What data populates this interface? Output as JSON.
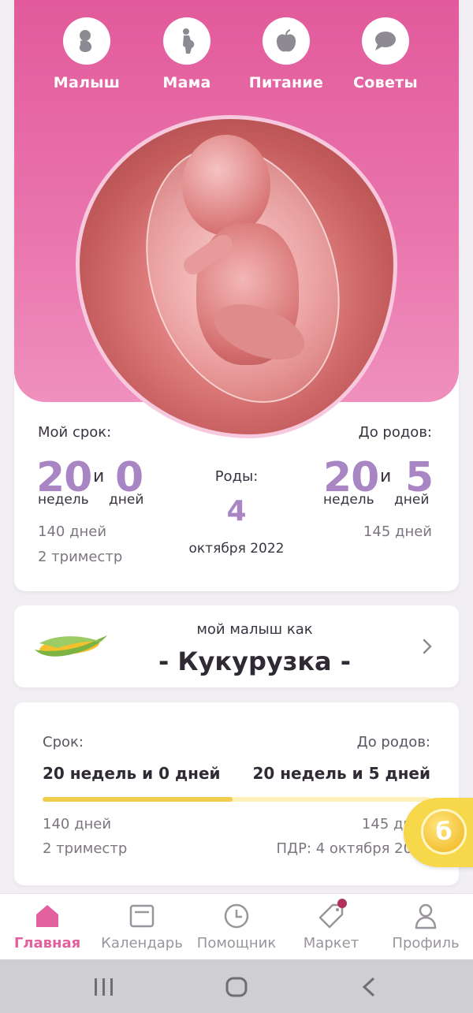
{
  "categories": [
    {
      "label": "Малыш",
      "icon": "baby-icon"
    },
    {
      "label": "Мама",
      "icon": "pregnant-mother-icon"
    },
    {
      "label": "Питание",
      "icon": "apple-icon"
    },
    {
      "label": "Советы",
      "icon": "chat-bubble-icon"
    }
  ],
  "summary": {
    "my_term_label": "Мой срок:",
    "my_weeks": "20",
    "my_and": "и",
    "my_days": "0",
    "weeks_unit": "недель",
    "days_unit": "дней",
    "my_total_days": "140 дней",
    "trimester": "2 триместр",
    "birth_label": "Роды:",
    "birth_day": "4",
    "birth_month_year": "октября 2022",
    "to_birth_label": "До родов:",
    "left_weeks": "20",
    "left_and": "и",
    "left_days": "5",
    "left_total_days": "145 дней"
  },
  "fruit": {
    "caption": "мой малыш как",
    "name": "- Кукурузка -",
    "icon": "corn-icon"
  },
  "progress": {
    "term_label": "Срок:",
    "term_value": "20 недель и 0 дней",
    "to_birth_label": "До родов:",
    "to_birth_value": "20 недель и 5 дней",
    "percent": 49,
    "days_passed": "140 дней",
    "trimester": "2 триместр",
    "days_left": "145 дней",
    "due_date": "ПДР: 4 октября 2022"
  },
  "nav": [
    {
      "label": "Главная",
      "icon": "home-icon",
      "active": true
    },
    {
      "label": "Календарь",
      "icon": "calendar-icon",
      "active": false
    },
    {
      "label": "Помощник",
      "icon": "clock-icon",
      "active": false
    },
    {
      "label": "Маркет",
      "icon": "price-tag-icon",
      "active": false
    },
    {
      "label": "Профиль",
      "icon": "profile-icon",
      "active": false
    }
  ],
  "colors": {
    "accent": "#e25a9b",
    "number": "#a985c4",
    "progress": "#f2cc4d"
  }
}
